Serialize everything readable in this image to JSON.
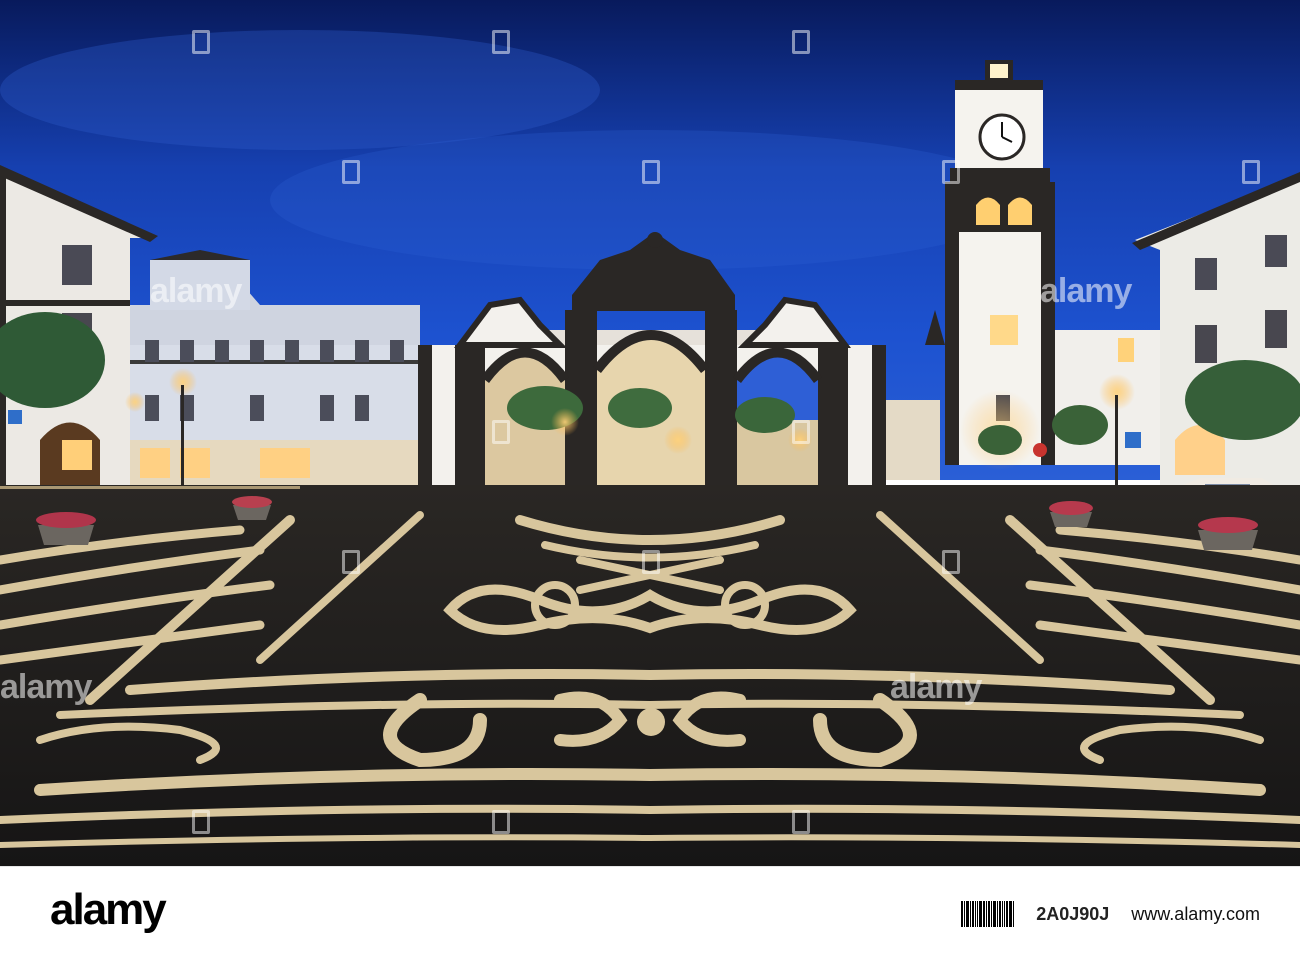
{
  "photo": {
    "colors": {
      "sky_top": "#0b1f66",
      "sky_mid": "#1a49c2",
      "pavement_dark": "#1e1d1c",
      "pavement_light": "#d9c9a3",
      "lamp_glow": "#ffc866",
      "wall_white": "#f2f0ec",
      "basalt": "#2a2725"
    }
  },
  "watermark": {
    "text": "alamy"
  },
  "footer": {
    "brand": "alamy",
    "image_id": "2A0J90J",
    "url": "www.alamy.com"
  }
}
